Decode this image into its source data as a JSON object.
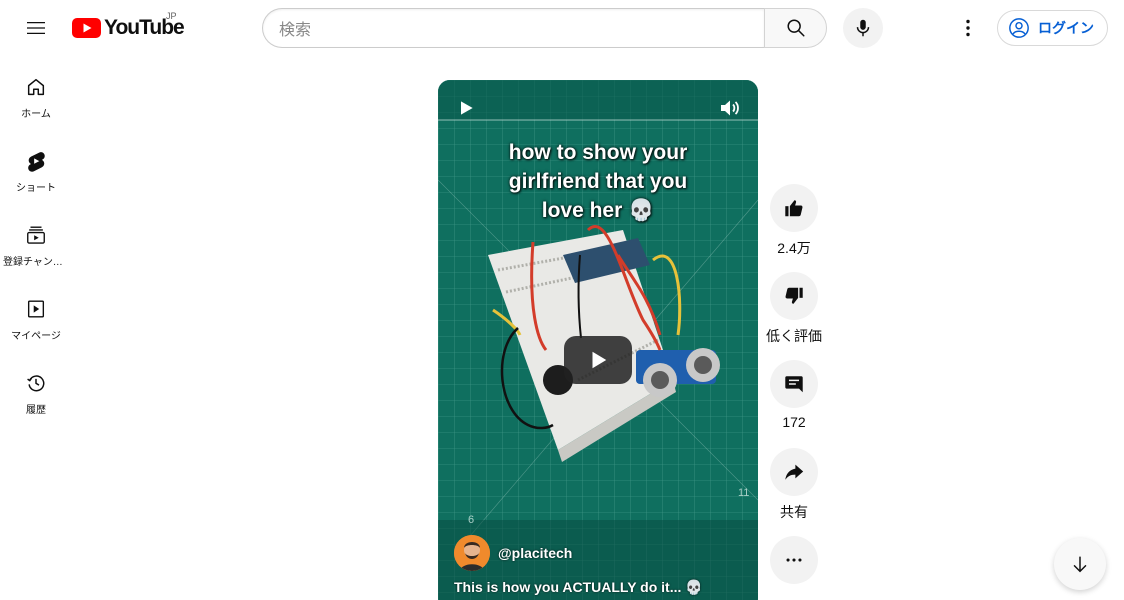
{
  "header": {
    "logo_text": "YouTube",
    "country_code": "JP",
    "search_placeholder": "検索",
    "login_label": "ログイン"
  },
  "sidebar": {
    "items": [
      {
        "label": "ホーム",
        "icon": "home-icon"
      },
      {
        "label": "ショート",
        "icon": "shorts-icon"
      },
      {
        "label": "登録チャンネル",
        "icon": "subscriptions-icon"
      },
      {
        "label": "マイページ",
        "icon": "you-icon"
      },
      {
        "label": "履歴",
        "icon": "history-icon"
      }
    ]
  },
  "video": {
    "overlay_lines": [
      "how to show your",
      "girlfriend that you",
      "love her 💀"
    ],
    "channel_handle": "@placitech",
    "title": "This is how you ACTUALLY do it... 💀"
  },
  "actions": {
    "like_count": "2.4万",
    "dislike_label": "低く評価",
    "comment_count": "172",
    "share_label": "共有"
  },
  "colors": {
    "brand_red": "#ff0000",
    "link_blue": "#065fd4",
    "mat_green": "#0f6f5f"
  }
}
